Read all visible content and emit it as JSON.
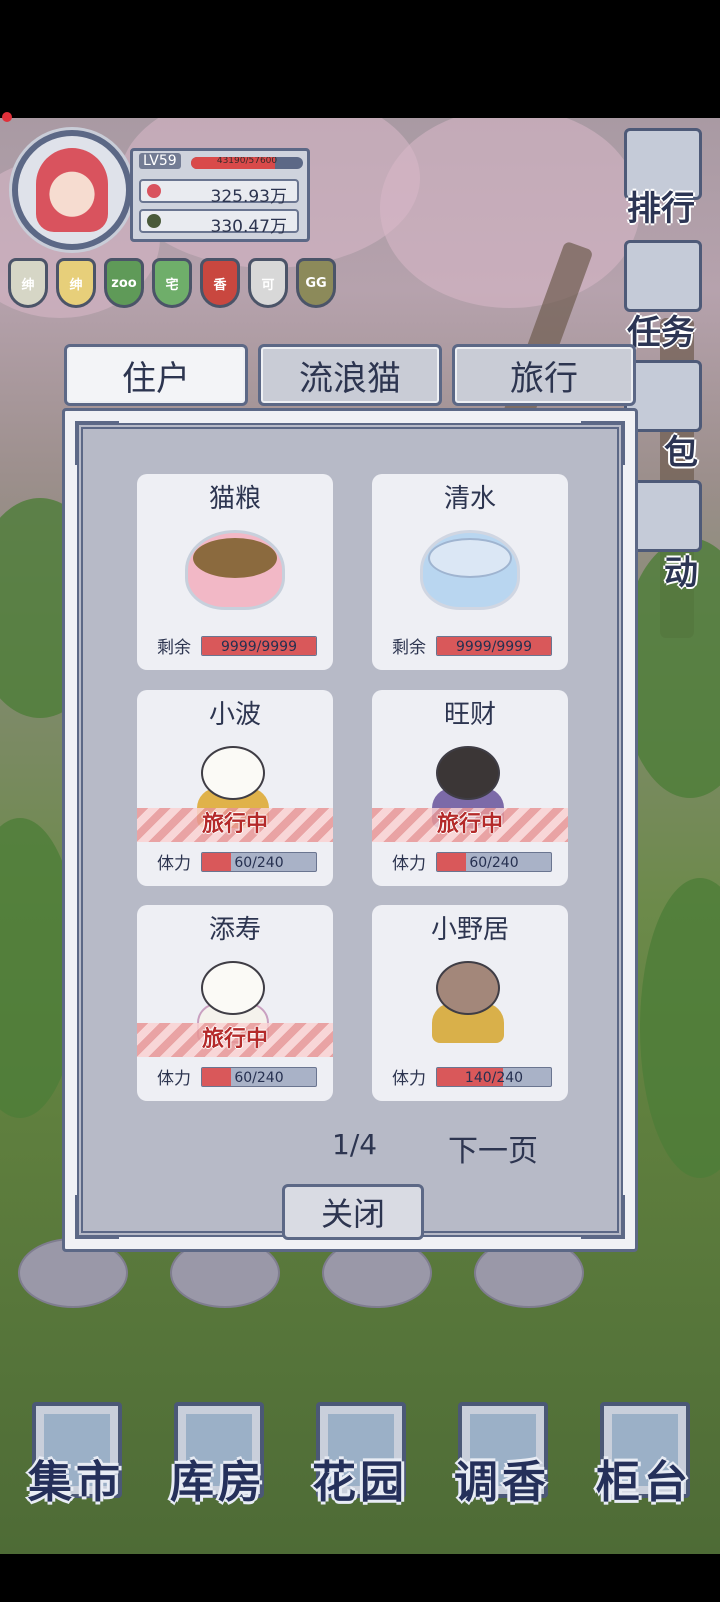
{
  "player": {
    "level": "LV59",
    "exp_text": "43190/57600",
    "exp_fraction": 0.75,
    "currency_1": "325.93万",
    "currency_2": "330.47万"
  },
  "badges": [
    {
      "label": "绅",
      "color": "#d6d6c6"
    },
    {
      "label": "绅",
      "color": "#e7cf7a"
    },
    {
      "label": "zoo",
      "color": "#5f9a58"
    },
    {
      "label": "宅",
      "color": "#6fae6a"
    },
    {
      "label": "香",
      "color": "#c9473f"
    },
    {
      "label": "可",
      "color": "#d8d8d8"
    },
    {
      "label": "GG",
      "color": "#8c8a5a"
    }
  ],
  "side_menu": {
    "rank": "排行",
    "tasks": "任务",
    "bag": "包",
    "events": "动"
  },
  "tabs": {
    "residents": "住户",
    "strays": "流浪猫",
    "travel": "旅行",
    "active": "residents"
  },
  "supplies": [
    {
      "name": "猫粮",
      "meter_label": "剩余",
      "value": "9999/9999",
      "fraction": 1.0,
      "color": "#f2b8c6",
      "fill": "#8b6a3e"
    },
    {
      "name": "清水",
      "meter_label": "剩余",
      "value": "9999/9999",
      "fraction": 1.0,
      "color": "#b9d6f0",
      "fill": "#dbe7f5"
    }
  ],
  "cats": [
    {
      "name": "小波",
      "meter_label": "体力",
      "value": "60/240",
      "fraction": 0.25,
      "status": "旅行中",
      "body": "#e0b24a"
    },
    {
      "name": "旺财",
      "meter_label": "体力",
      "value": "60/240",
      "fraction": 0.25,
      "status": "旅行中",
      "body": "#3b3636"
    },
    {
      "name": "添寿",
      "meter_label": "体力",
      "value": "60/240",
      "fraction": 0.25,
      "status": "旅行中",
      "body": "#f4f2ec"
    },
    {
      "name": "小野居",
      "meter_label": "体力",
      "value": "140/240",
      "fraction": 0.583,
      "status": "",
      "body": "#d9b04a"
    }
  ],
  "pagination": {
    "page": "1/4",
    "next": "下一页"
  },
  "close_label": "关闭",
  "bottom_nav": [
    "集市",
    "库房",
    "花园",
    "调香",
    "柜台"
  ]
}
